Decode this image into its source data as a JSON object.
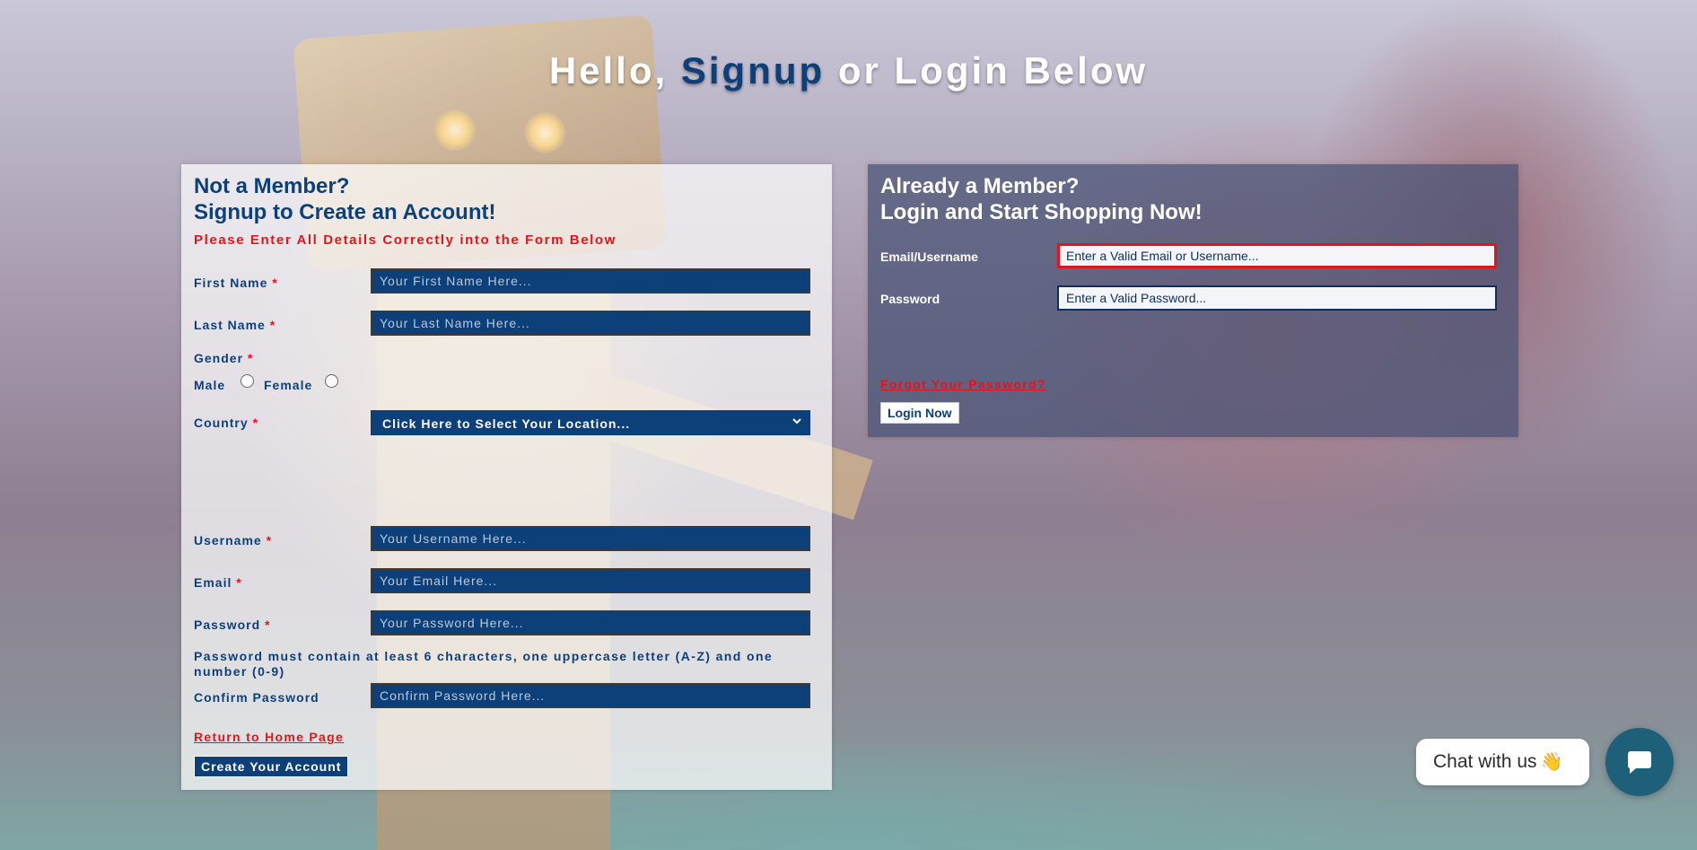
{
  "title": {
    "part1": "Hello, ",
    "accent": "Signup",
    "part2": " or Login Below"
  },
  "signup": {
    "heading_line1": "Not a Member?",
    "heading_line2": "Signup to Create an Account!",
    "notice": "Please Enter All Details Correctly into the Form Below",
    "required_mark": "*",
    "first_name": {
      "label": "First Name",
      "placeholder": "Your First Name Here..."
    },
    "last_name": {
      "label": "Last Name",
      "placeholder": "Your Last Name Here..."
    },
    "gender": {
      "label": "Gender",
      "male": "Male",
      "female": "Female"
    },
    "country": {
      "label": "Country",
      "selected": "Click Here to Select Your Location..."
    },
    "username": {
      "label": "Username",
      "placeholder": "Your Username Here..."
    },
    "email": {
      "label": "Email",
      "placeholder": "Your Email Here..."
    },
    "password": {
      "label": "Password",
      "placeholder": "Your Password Here..."
    },
    "password_hint": "Password must contain at least 6 characters, one uppercase letter (A-Z) and one number (0-9)",
    "confirm_password": {
      "label": "Confirm Password",
      "placeholder": "Confirm Password Here..."
    },
    "return_link": "Return to Home Page",
    "submit_label": "Create Your Account"
  },
  "login": {
    "heading_line1": "Already a Member?",
    "heading_line2": "Login and Start Shopping Now!",
    "email_label": "Email/Username",
    "email_placeholder": "Enter a Valid Email or Username...",
    "password_label": "Password",
    "password_placeholder": "Enter a Valid Password...",
    "forgot_link": "Forgot Your Password?",
    "submit_label": "Login Now"
  },
  "chat": {
    "label": "Chat with us",
    "emoji": "👋",
    "icon": "chat-bubble-icon"
  },
  "colors": {
    "brand_blue": "#0d4079",
    "error_red": "#e3151c",
    "chat_teal": "#1e5f7a"
  }
}
